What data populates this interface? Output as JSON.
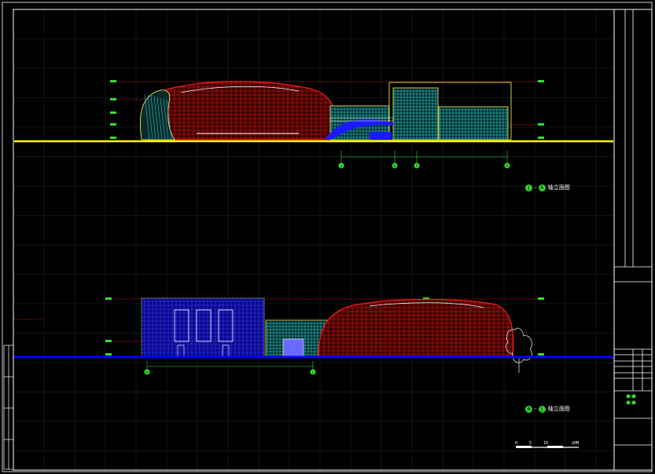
{
  "drawing": {
    "colors": {
      "background": "#000000",
      "grid": "#2a3a4a",
      "frame": "#ffffff",
      "dome": "#ff1a1a",
      "glass": "#2ee6e6",
      "blue_block": "#1a1aff",
      "ground_top": "#ffff00",
      "ground_bottom": "#0000ff",
      "dimension": "#33dd33",
      "level_marker": "#33dd33"
    },
    "elevation_top": {
      "caption_tag_start": "J",
      "caption_tag_end": "A",
      "caption_text": "轴立面图",
      "axis_tags": [
        "J",
        "G",
        "F",
        "A"
      ]
    },
    "elevation_bottom": {
      "caption_tag_start": "A",
      "caption_tag_end": "J",
      "caption_text": "轴立面图",
      "axis_tags": [
        "A",
        "J"
      ]
    },
    "scale_bar": {
      "labels": [
        "0",
        "5",
        "10",
        "20M"
      ]
    },
    "title_block": {
      "small_tags": [
        "S",
        "S",
        "S",
        "S"
      ]
    }
  }
}
